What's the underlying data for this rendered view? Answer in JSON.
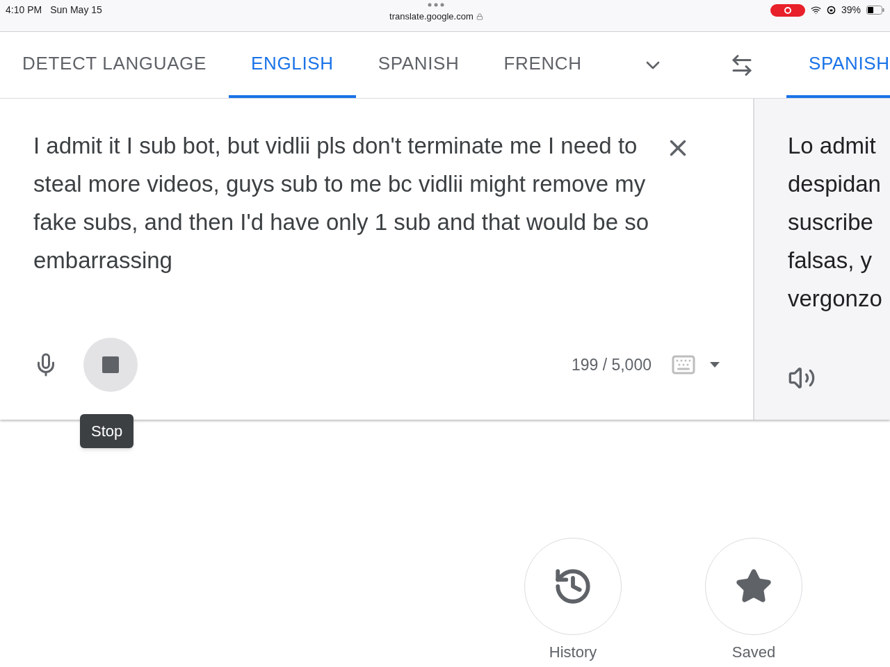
{
  "status_bar": {
    "time": "4:10 PM",
    "date": "Sun May 15",
    "url": "translate.google.com",
    "battery": "39%",
    "recording": true
  },
  "source_tabs": [
    {
      "label": "DETECT LANGUAGE",
      "selected": false
    },
    {
      "label": "ENGLISH",
      "selected": true
    },
    {
      "label": "SPANISH",
      "selected": false
    },
    {
      "label": "FRENCH",
      "selected": false
    }
  ],
  "target_tabs": [
    {
      "label": "SPANISH",
      "selected": true
    }
  ],
  "source": {
    "text": "I admit it I sub bot, but vidlii pls don't terminate me I need to steal more videos, guys sub to me bc vidlii might remove my fake subs, and then I'd have only 1 sub and that would be so embarrassing",
    "count": "199 / 5,000"
  },
  "tooltip": "Stop",
  "target": {
    "lines": [
      "Lo admit",
      "despidan",
      "suscribe",
      "falsas, y",
      "vergonzo"
    ]
  },
  "shortcuts": [
    {
      "kind": "history",
      "label": "History"
    },
    {
      "kind": "saved",
      "label": "Saved"
    }
  ]
}
